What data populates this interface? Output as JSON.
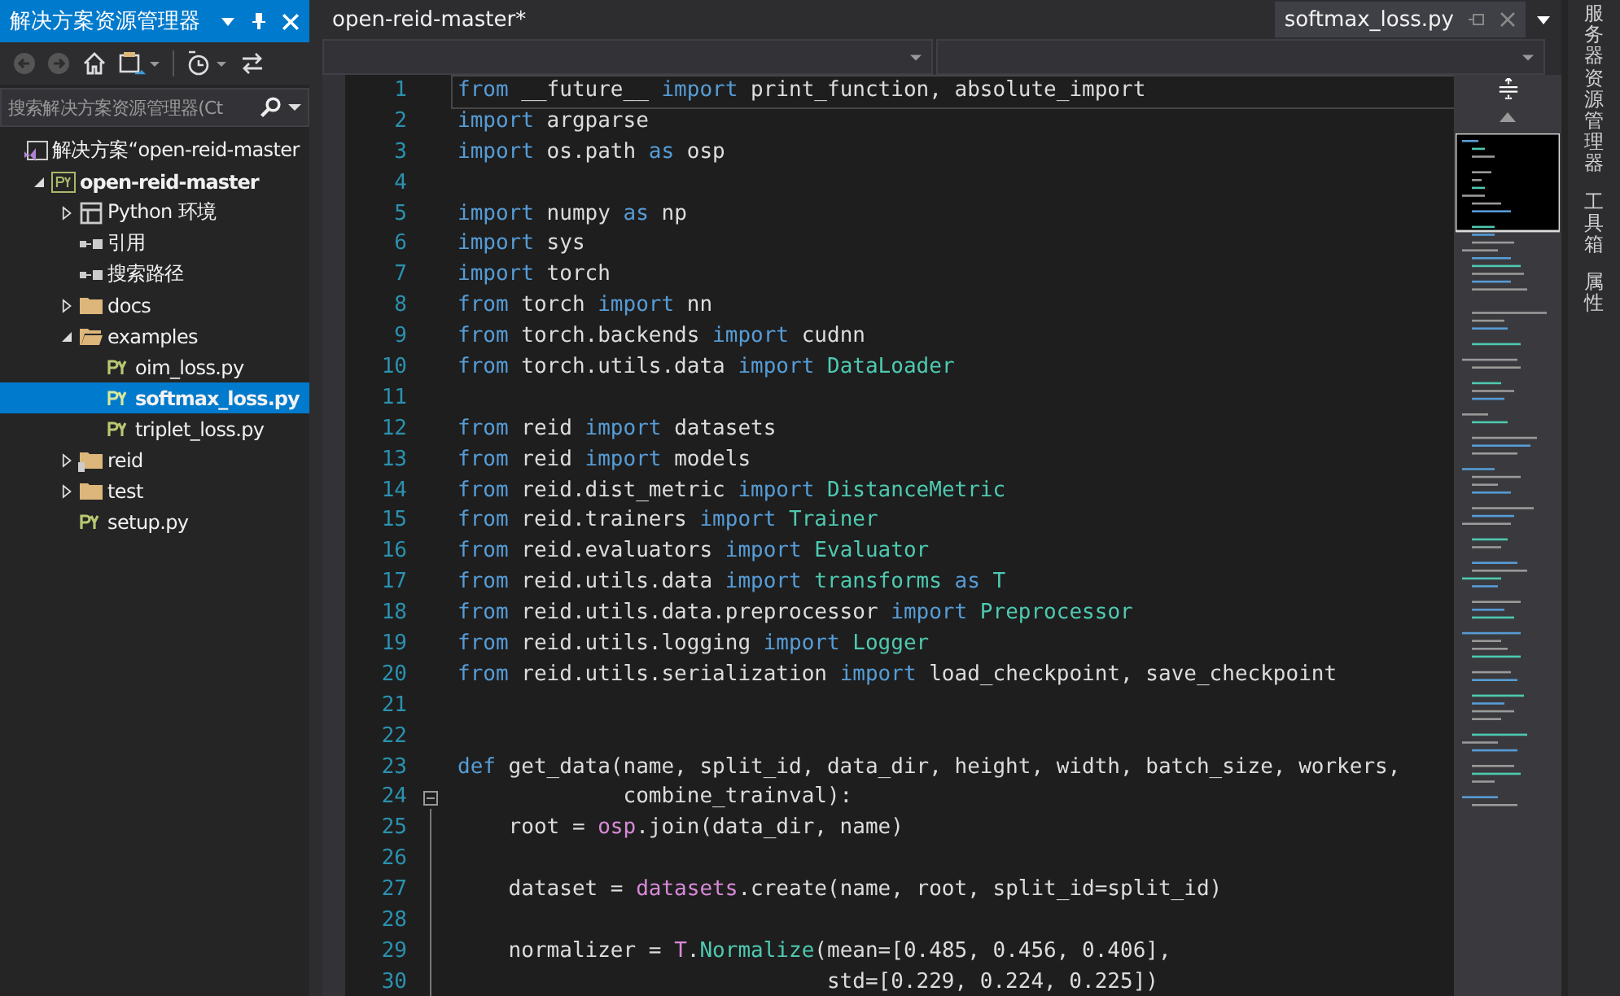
{
  "explorer": {
    "title": "解决方案资源管理器",
    "search": {
      "placeholder": "搜索解决方案资源管理器(Ct"
    },
    "tree": [
      {
        "label": "解决方案“open-reid-master",
        "kind": "solution",
        "selected": false,
        "children": [
          {
            "label": "open-reid-master",
            "kind": "project",
            "selected": false,
            "expanded": true,
            "children": [
              {
                "label": "Python 环境",
                "kind": "env",
                "selected": false,
                "expanded": false
              },
              {
                "label": "引用",
                "kind": "ref",
                "selected": false
              },
              {
                "label": "搜索路径",
                "kind": "ref",
                "selected": false
              },
              {
                "label": "docs",
                "kind": "folder",
                "selected": false,
                "expanded": false
              },
              {
                "label": "examples",
                "kind": "folder",
                "selected": false,
                "expanded": true,
                "children": [
                  {
                    "label": "oim_loss.py",
                    "kind": "py",
                    "selected": false
                  },
                  {
                    "label": "softmax_loss.py",
                    "kind": "py",
                    "selected": true
                  },
                  {
                    "label": "triplet_loss.py",
                    "kind": "py",
                    "selected": false
                  }
                ]
              },
              {
                "label": "reid",
                "kind": "package",
                "selected": false,
                "expanded": false
              },
              {
                "label": "test",
                "kind": "folder",
                "selected": false,
                "expanded": false
              },
              {
                "label": "setup.py",
                "kind": "py",
                "selected": false
              }
            ]
          }
        ]
      }
    ]
  },
  "editor": {
    "project_tab": "open-reid-master*",
    "file_tab": {
      "label": "softmax_loss.py",
      "selected": true
    },
    "lines": [
      {
        "number": "1",
        "tokens": [
          {
            "kind": "kw",
            "text": "from"
          },
          {
            "kind": "txt",
            "text": " __future__ "
          },
          {
            "kind": "kw",
            "text": "import"
          },
          {
            "kind": "txt",
            "text": " print_function, absolute_import"
          }
        ]
      },
      {
        "number": "2",
        "tokens": [
          {
            "kind": "kw",
            "text": "import"
          },
          {
            "kind": "txt",
            "text": " argparse"
          }
        ]
      },
      {
        "number": "3",
        "tokens": [
          {
            "kind": "kw",
            "text": "import"
          },
          {
            "kind": "txt",
            "text": " os.path "
          },
          {
            "kind": "kw",
            "text": "as"
          },
          {
            "kind": "txt",
            "text": " osp"
          }
        ]
      },
      {
        "number": "4"
      },
      {
        "number": "5",
        "tokens": [
          {
            "kind": "kw",
            "text": "import"
          },
          {
            "kind": "txt",
            "text": " numpy "
          },
          {
            "kind": "kw",
            "text": "as"
          },
          {
            "kind": "txt",
            "text": " np"
          }
        ]
      },
      {
        "number": "6",
        "tokens": [
          {
            "kind": "kw",
            "text": "import"
          },
          {
            "kind": "txt",
            "text": " sys"
          }
        ]
      },
      {
        "number": "7",
        "tokens": [
          {
            "kind": "kw",
            "text": "import"
          },
          {
            "kind": "txt",
            "text": " torch"
          }
        ]
      },
      {
        "number": "8",
        "tokens": [
          {
            "kind": "kw",
            "text": "from"
          },
          {
            "kind": "txt",
            "text": " torch "
          },
          {
            "kind": "kw",
            "text": "import"
          },
          {
            "kind": "txt",
            "text": " nn"
          }
        ]
      },
      {
        "number": "9",
        "tokens": [
          {
            "kind": "kw",
            "text": "from"
          },
          {
            "kind": "txt",
            "text": " torch.backends "
          },
          {
            "kind": "kw",
            "text": "import"
          },
          {
            "kind": "txt",
            "text": " cudnn"
          }
        ]
      },
      {
        "number": "10",
        "tokens": [
          {
            "kind": "kw",
            "text": "from"
          },
          {
            "kind": "txt",
            "text": " torch.utils.data "
          },
          {
            "kind": "kw",
            "text": "import "
          },
          {
            "kind": "cls",
            "text": "DataLoader"
          }
        ]
      },
      {
        "number": "11"
      },
      {
        "number": "12",
        "tokens": [
          {
            "kind": "kw",
            "text": "from"
          },
          {
            "kind": "txt",
            "text": " reid "
          },
          {
            "kind": "kw",
            "text": "import"
          },
          {
            "kind": "txt",
            "text": " datasets"
          }
        ]
      },
      {
        "number": "13",
        "tokens": [
          {
            "kind": "kw",
            "text": "from"
          },
          {
            "kind": "txt",
            "text": " reid "
          },
          {
            "kind": "kw",
            "text": "import"
          },
          {
            "kind": "txt",
            "text": " models"
          }
        ]
      },
      {
        "number": "14",
        "tokens": [
          {
            "kind": "kw",
            "text": "from"
          },
          {
            "kind": "txt",
            "text": " reid.dist_metric "
          },
          {
            "kind": "kw",
            "text": "import "
          },
          {
            "kind": "cls",
            "text": "DistanceMetric"
          }
        ]
      },
      {
        "number": "15",
        "tokens": [
          {
            "kind": "kw",
            "text": "from"
          },
          {
            "kind": "txt",
            "text": " reid.trainers "
          },
          {
            "kind": "kw",
            "text": "import "
          },
          {
            "kind": "cls",
            "text": "Trainer"
          }
        ]
      },
      {
        "number": "16",
        "tokens": [
          {
            "kind": "kw",
            "text": "from"
          },
          {
            "kind": "txt",
            "text": " reid.evaluators "
          },
          {
            "kind": "kw",
            "text": "import "
          },
          {
            "kind": "cls",
            "text": "Evaluator"
          }
        ]
      },
      {
        "number": "17",
        "tokens": [
          {
            "kind": "kw",
            "text": "from"
          },
          {
            "kind": "txt",
            "text": " reid.utils.data "
          },
          {
            "kind": "kw",
            "text": "import "
          },
          {
            "kind": "cls",
            "text": "transforms"
          },
          {
            "kind": "kw",
            "text": " as "
          },
          {
            "kind": "cls",
            "text": "T"
          }
        ]
      },
      {
        "number": "18",
        "tokens": [
          {
            "kind": "kw",
            "text": "from"
          },
          {
            "kind": "txt",
            "text": " reid.utils.data.preprocessor "
          },
          {
            "kind": "kw",
            "text": "import "
          },
          {
            "kind": "cls",
            "text": "Preprocessor"
          }
        ]
      },
      {
        "number": "19",
        "tokens": [
          {
            "kind": "kw",
            "text": "from"
          },
          {
            "kind": "txt",
            "text": " reid.utils.logging "
          },
          {
            "kind": "kw",
            "text": "import "
          },
          {
            "kind": "cls",
            "text": "Logger"
          }
        ]
      },
      {
        "number": "20",
        "tokens": [
          {
            "kind": "kw",
            "text": "from"
          },
          {
            "kind": "txt",
            "text": " reid.utils.serialization "
          },
          {
            "kind": "kw",
            "text": "import"
          },
          {
            "kind": "txt",
            "text": " load_checkpoint, save_checkpoint"
          }
        ]
      },
      {
        "number": "21"
      },
      {
        "number": "22"
      },
      {
        "number": "23",
        "tokens": [
          {
            "kind": "kw",
            "text": "def"
          },
          {
            "kind": "txt",
            "text": " get_data(name, split_id, data_dir, height, width, batch_size, workers,"
          }
        ]
      },
      {
        "number": "24",
        "fold": true,
        "tokens": [
          {
            "kind": "txt",
            "text": "             combine_trainval):"
          }
        ]
      },
      {
        "number": "25",
        "tokens": [
          {
            "kind": "txt",
            "text": "    root = "
          },
          {
            "kind": "mod",
            "text": "osp"
          },
          {
            "kind": "txt",
            "text": ".join(data_dir, name)"
          }
        ]
      },
      {
        "number": "26"
      },
      {
        "number": "27",
        "tokens": [
          {
            "kind": "txt",
            "text": "    dataset = "
          },
          {
            "kind": "mod",
            "text": "datasets"
          },
          {
            "kind": "txt",
            "text": ".create(name, root, split_id=split_id)"
          }
        ]
      },
      {
        "number": "28"
      },
      {
        "number": "29",
        "tokens": [
          {
            "kind": "txt",
            "text": "    normalizer = "
          },
          {
            "kind": "mod",
            "text": "T"
          },
          {
            "kind": "txt",
            "text": "."
          },
          {
            "kind": "cls",
            "text": "Normalize"
          },
          {
            "kind": "txt",
            "text": "(mean=[0.485, 0.456, 0.406],"
          }
        ]
      },
      {
        "number": "30",
        "tokens": [
          {
            "kind": "txt",
            "text": "                             std=[0.229, 0.224, 0.225])"
          }
        ]
      }
    ]
  },
  "side_tabs": [
    "服务器资源管理器",
    "工具箱",
    "属性"
  ]
}
